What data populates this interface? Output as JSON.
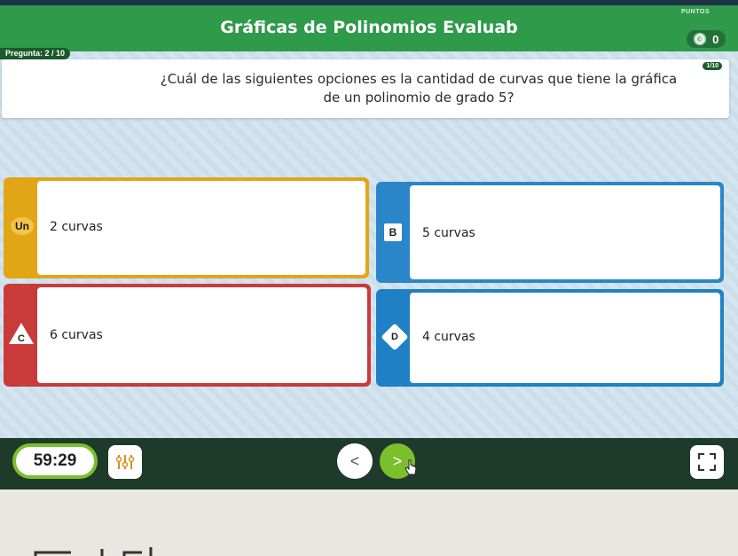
{
  "header": {
    "title": "Gráficas de Polinomios Evaluab",
    "points_label": "PUNTOS",
    "score": "0",
    "coin_symbol": "©"
  },
  "question": {
    "counter_tag": "Pregunta: 2 / 10",
    "small_badge": "1/10",
    "text": "¿Cuál de las siguientes opciones es la cantidad de curvas que tiene la gráfica de un polinomio de grado 5?"
  },
  "answers": [
    {
      "letter": "Un",
      "label": "2 curvas",
      "shape": "circle-icon",
      "color": "#e2a516"
    },
    {
      "letter": "B",
      "label": "5 curvas",
      "shape": "square-icon",
      "color": "#2a86c8"
    },
    {
      "letter": "C",
      "label": "6 curvas",
      "shape": "triangle-icon",
      "color": "#c93b3b"
    },
    {
      "letter": "D",
      "label": "4 curvas",
      "shape": "cross-icon",
      "color": "#1f80c6"
    }
  ],
  "footer": {
    "timer": "59:29",
    "prev_symbol": "<",
    "next_symbol": ">"
  },
  "colors": {
    "header_green": "#2e9a4a",
    "accent_lime": "#7bbf2d",
    "footer_dark": "#1d3a2b"
  }
}
